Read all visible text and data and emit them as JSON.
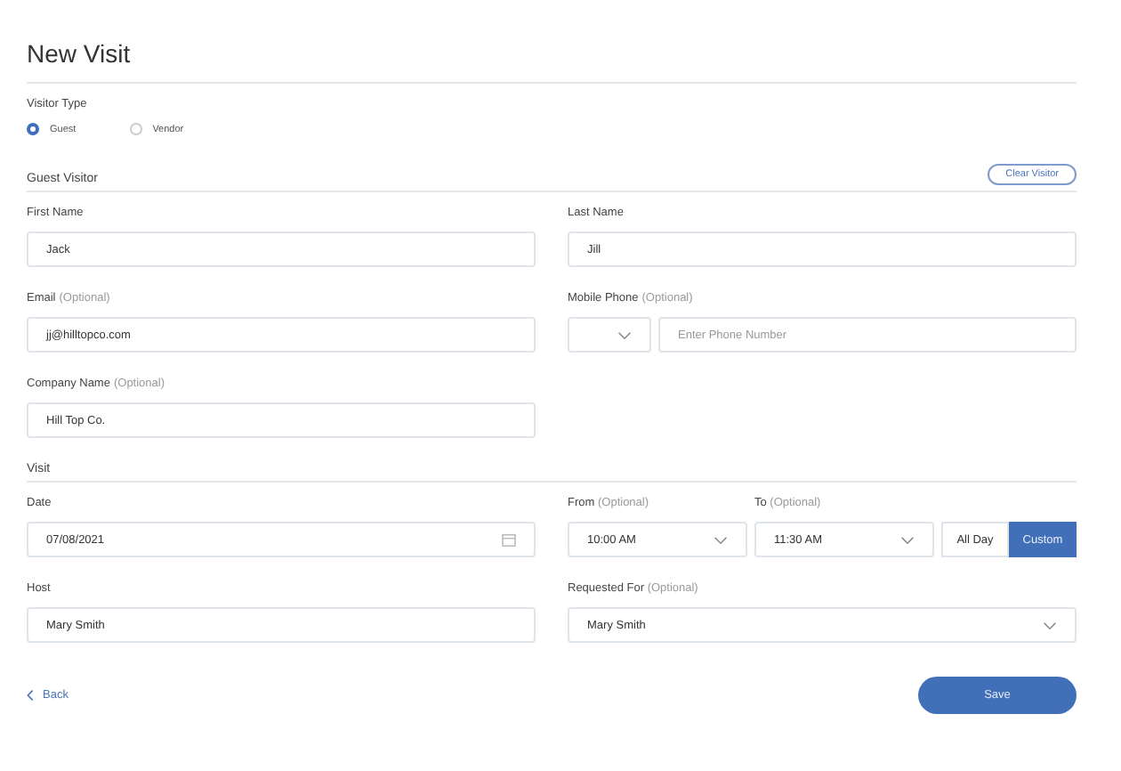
{
  "title": "New Visit",
  "visitor_type": {
    "label": "Visitor Type",
    "options": [
      {
        "label": "Guest",
        "selected": true
      },
      {
        "label": "Vendor",
        "selected": false
      }
    ]
  },
  "guest_visitor": {
    "heading": "Guest Visitor",
    "clear_button": "Clear Visitor",
    "fields": [
      {
        "kind": "text",
        "label": "First Name",
        "value": "Jack"
      },
      {
        "kind": "text",
        "label": "Last Name",
        "value": "Jill"
      },
      {
        "kind": "text",
        "label": "Email",
        "optional": "(Optional)",
        "value": "jj@hilltopco.com"
      },
      {
        "kind": "phone",
        "label": "Mobile Phone",
        "optional": "(Optional)",
        "placeholder": "Enter Phone Number"
      },
      {
        "kind": "text",
        "label": "Company Name",
        "optional": "(Optional)",
        "value": "Hill Top Co."
      }
    ]
  },
  "visit": {
    "heading": "Visit",
    "date": {
      "label": "Date",
      "value": "07/08/2021"
    },
    "from": {
      "label": "From",
      "optional": "(Optional)",
      "value": "10:00 AM"
    },
    "to": {
      "label": "To",
      "optional": "(Optional)",
      "value": "11:30 AM"
    },
    "range": [
      {
        "label": "All Day",
        "selected": false
      },
      {
        "label": "Custom",
        "selected": true
      }
    ],
    "host": {
      "label": "Host",
      "value": "Mary Smith"
    },
    "requested_for": {
      "label": "Requested For",
      "optional": "(Optional)",
      "value": "Mary Smith"
    }
  },
  "back": "Back",
  "save": "Save"
}
